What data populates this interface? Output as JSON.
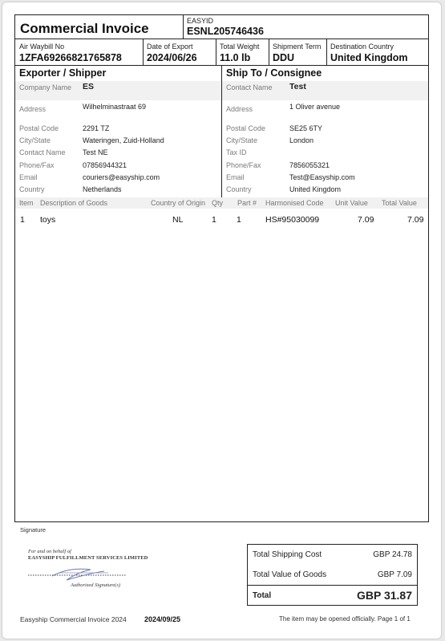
{
  "header": {
    "title": "Commercial Invoice",
    "easyid_label": "EASYID",
    "easyid_value": "ESNL205746436"
  },
  "shipment": {
    "awb_label": "Air Waybill No",
    "awb_value": "1ZFA69266821765878",
    "date_label": "Date of Export",
    "date_value": "2024/06/26",
    "weight_label": "Total Weight",
    "weight_value": "11.0 lb",
    "term_label": "Shipment Term",
    "term_value": "DDU",
    "dest_label": "Destination Country",
    "dest_value": "United Kingdom"
  },
  "exporter": {
    "heading": "Exporter / Shipper",
    "company_label": "Company Name",
    "company_value": "ES",
    "address_label": "Address",
    "address_value": "Wilhelminastraat 69",
    "postal_label": "Postal Code",
    "postal_value": "2291 TZ",
    "city_label": "City/State",
    "city_value": "Wateringen, Zuid-Holland",
    "contact_label": "Contact Name",
    "contact_value": "Test NE",
    "phone_label": "Phone/Fax",
    "phone_value": "07856944321",
    "email_label": "Email",
    "email_value": "couriers@easyship.com",
    "country_label": "Country",
    "country_value": "Netherlands"
  },
  "consignee": {
    "heading": "Ship To / Consignee",
    "contact_label": "Contact Name",
    "contact_value": "Test",
    "address_label": "Address",
    "address_value": "1 Oliver avenue",
    "postal_label": "Postal Code",
    "postal_value": "SE25 6TY",
    "city_label": "City/State",
    "city_value": "London",
    "taxid_label": "Tax ID",
    "taxid_value": "",
    "phone_label": "Phone/Fax",
    "phone_value": "7856055321",
    "email_label": "Email",
    "email_value": "Test@Easyship.com",
    "country_label": "Country",
    "country_value": "United Kingdom"
  },
  "items_table": {
    "headers": [
      "Item",
      "Description of Goods",
      "Country of Origin",
      "Qty",
      "Part #",
      "Harmonised Code",
      "Unit Value",
      "Total Value"
    ],
    "rows": [
      [
        "1",
        "toys",
        "NL",
        "1",
        "1",
        "HS#95030099",
        "7.09",
        "7.09"
      ]
    ]
  },
  "signature": {
    "label": "Signature",
    "line1": "For and on behalf of",
    "line2": "EASYSHIP FULFILLMENT SERVICES LIMITED",
    "line3": "Authorized Signature(s)"
  },
  "totals": {
    "shipping_label": "Total Shipping Cost",
    "shipping_value": "GBP 24.78",
    "goods_label": "Total Value of Goods",
    "goods_value": "GBP 7.09",
    "total_label": "Total",
    "total_value": "GBP 31.87"
  },
  "footer": {
    "left": "Easyship Commercial Invoice 2024",
    "date": "2024/09/25",
    "right": "The item may be opened officially. Page 1 of 1"
  }
}
